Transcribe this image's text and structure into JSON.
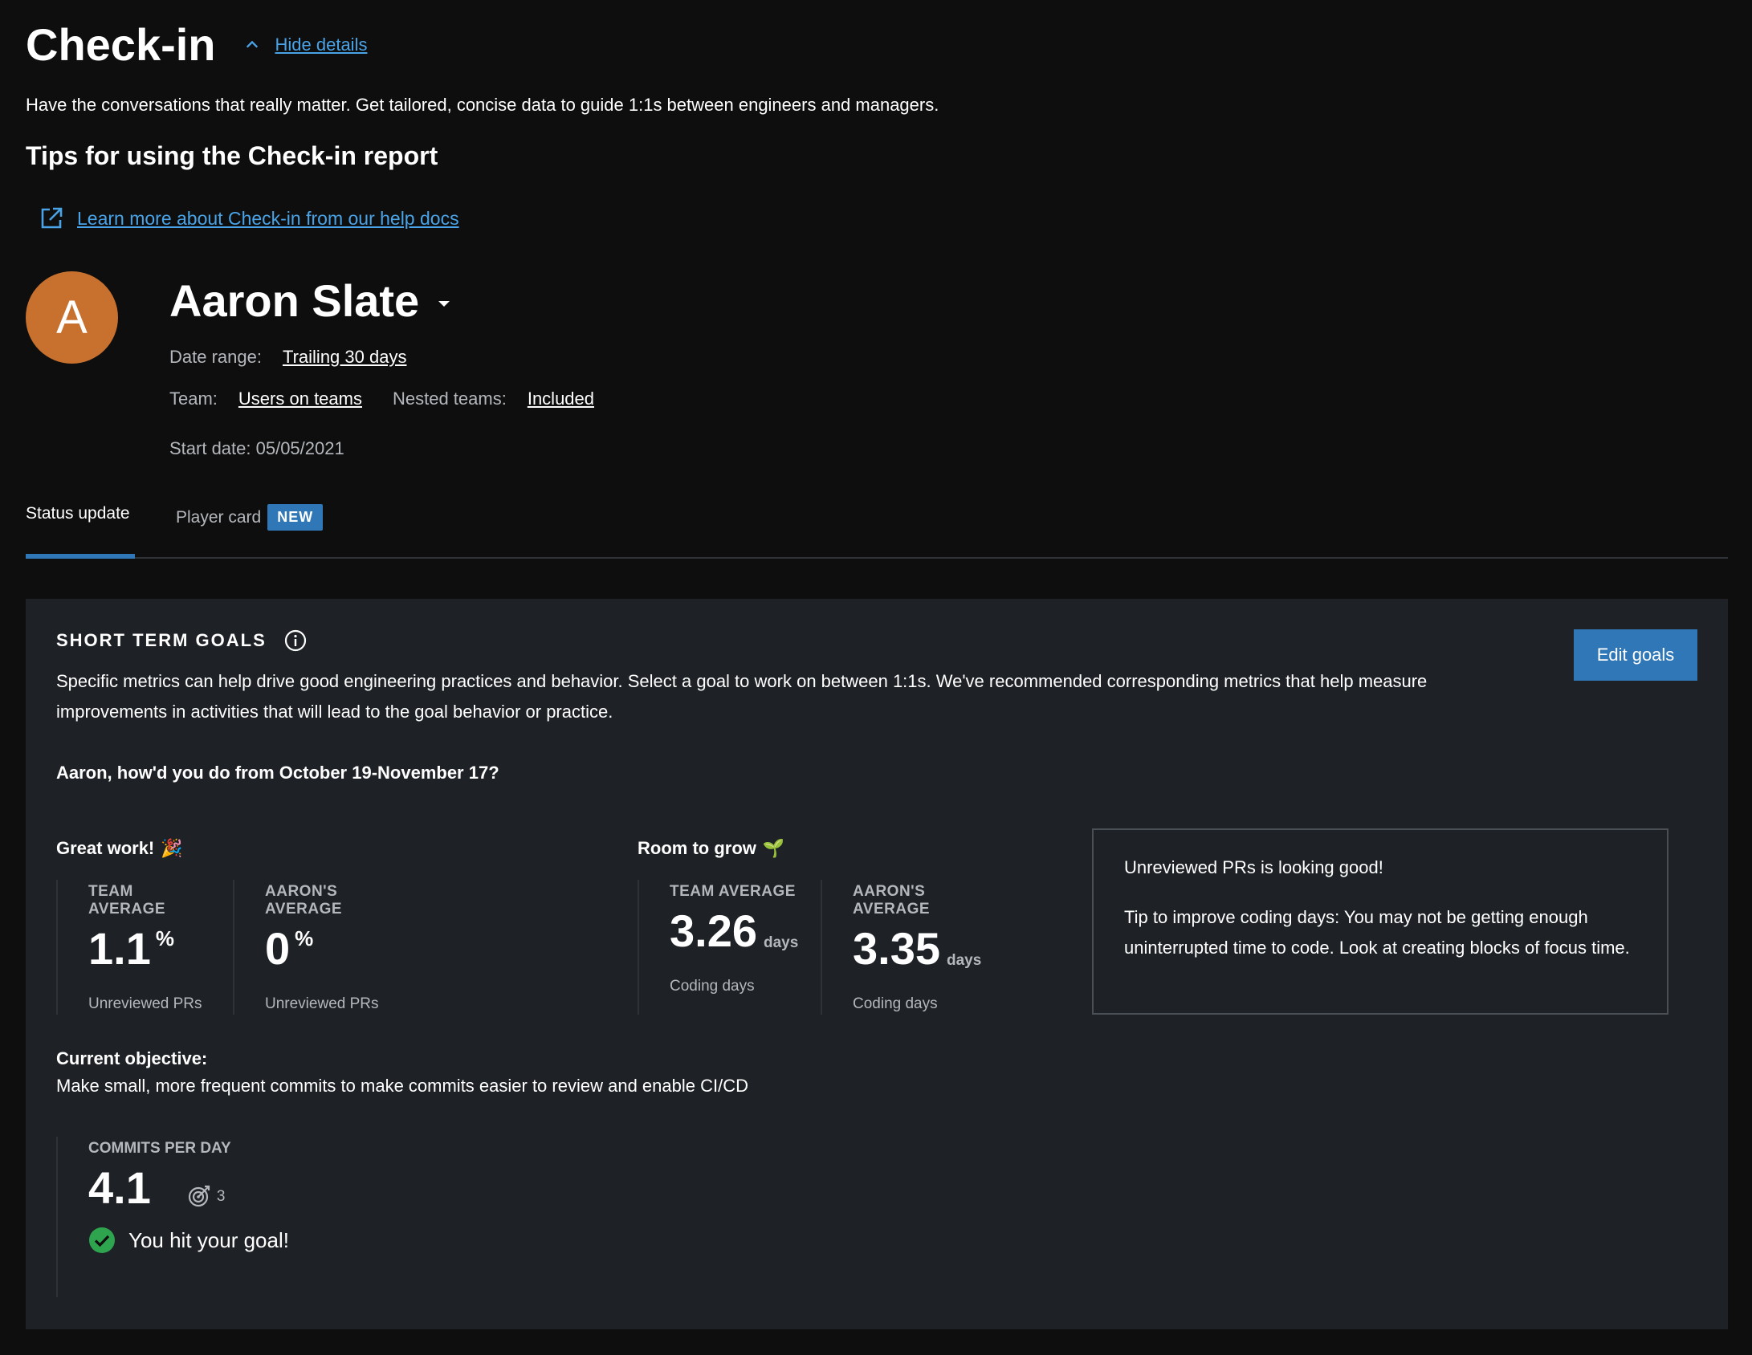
{
  "header": {
    "title": "Check-in",
    "hide_details": "Hide details",
    "subtitle": "Have the conversations that really matter. Get tailored, concise data to guide 1:1s between engineers and managers.",
    "tips_title": "Tips for using the Check-in report",
    "help_link": "Learn more about Check-in from our help docs"
  },
  "profile": {
    "avatar_letter": "A",
    "name": "Aaron Slate",
    "date_range_label": "Date range:",
    "date_range_value": "Trailing 30 days",
    "team_label": "Team:",
    "team_value": "Users on teams",
    "nested_label": "Nested teams:",
    "nested_value": "Included",
    "start_date": "Start date: 05/05/2021"
  },
  "tabs": [
    {
      "label": "Status update",
      "active": true
    },
    {
      "label": "Player card",
      "badge": "NEW",
      "active": false
    }
  ],
  "goals": {
    "title": "SHORT TERM GOALS",
    "edit_button": "Edit goals",
    "description": "Specific metrics can help drive good engineering practices and behavior. Select a goal to work on between 1:1s. We've recommended corresponding metrics that help measure improvements in activities that will lead to the goal behavior or practice.",
    "question": "Aaron, how'd you do from October 19-November 17?",
    "great": {
      "title": "Great work!",
      "emoji": "🎉",
      "metrics": [
        {
          "label": "TEAM AVERAGE",
          "value": "1.1",
          "unit": "%",
          "sub": "Unreviewed PRs"
        },
        {
          "label": "AARON'S AVERAGE",
          "value": "0",
          "unit": "%",
          "sub": "Unreviewed PRs"
        }
      ]
    },
    "grow": {
      "title": "Room to grow",
      "emoji": "🌱",
      "metrics": [
        {
          "label": "TEAM AVERAGE",
          "value": "3.26",
          "unit": "days",
          "sub": "Coding days"
        },
        {
          "label": "AARON'S AVERAGE",
          "value": "3.35",
          "unit": "days",
          "sub": "Coding days"
        }
      ]
    },
    "tip_box": {
      "line1": "Unreviewed PRs is looking good!",
      "line2": "Tip to improve coding days: You may not be getting enough uninterrupted time to code. Look at creating blocks of focus time."
    },
    "objective": {
      "title": "Current objective:",
      "text": "Make small, more frequent commits to make commits easier to review and enable CI/CD"
    },
    "commits": {
      "label": "COMMITS PER DAY",
      "value": "4.1",
      "target": "3",
      "hit_text": "You hit your goal!"
    }
  },
  "colors": {
    "accent": "#2f77b6",
    "link": "#4aa3e6",
    "avatar": "#c8702e",
    "success": "#2ea44f"
  }
}
